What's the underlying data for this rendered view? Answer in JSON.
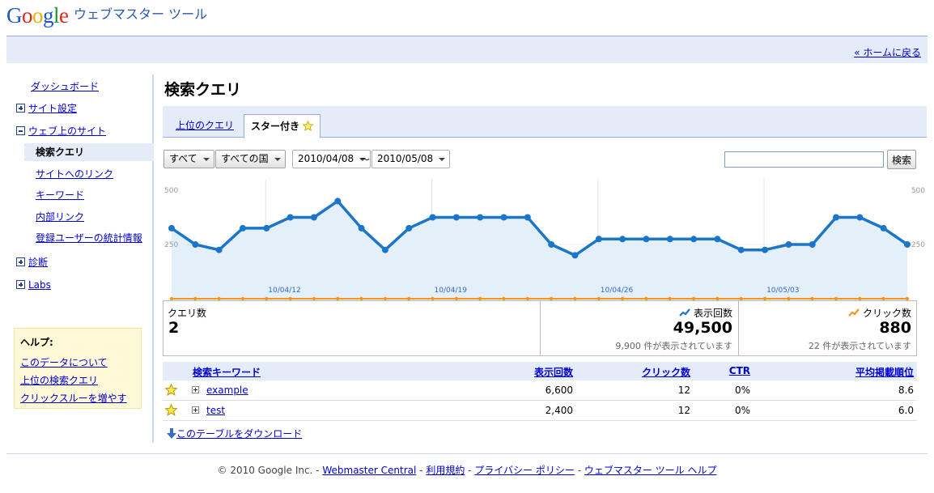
{
  "header": {
    "logo_text": "Google",
    "product_name": "ウェブマスター ツール",
    "home_link": "« ホームに戻る"
  },
  "sidebar": {
    "items": [
      {
        "label": "ダッシュボード",
        "type": "link"
      },
      {
        "label": "サイト設定",
        "type": "expandable",
        "expanded": false
      },
      {
        "label": "ウェブ上のサイト",
        "type": "expandable",
        "expanded": true
      },
      {
        "label": "検索クエリ",
        "type": "selected"
      },
      {
        "label": "サイトへのリンク",
        "type": "sub"
      },
      {
        "label": "キーワード",
        "type": "sub"
      },
      {
        "label": "内部リンク",
        "type": "sub"
      },
      {
        "label": "登録ユーザーの統計情報",
        "type": "sub"
      },
      {
        "label": "診断",
        "type": "expandable",
        "expanded": false
      },
      {
        "label": "Labs",
        "type": "expandable",
        "expanded": false
      }
    ],
    "help": {
      "title": "ヘルプ:",
      "links": [
        "このデータについて",
        "上位の検索クエリ",
        "クリックスルーを増やす"
      ]
    }
  },
  "main": {
    "title": "検索クエリ",
    "tabs": [
      {
        "label": "上位のクエリ",
        "active": false
      },
      {
        "label": "スター付き",
        "active": true
      }
    ],
    "filters": {
      "type": "すべて",
      "country": "すべての国",
      "date_from": "2010/04/08",
      "date_sep": "～",
      "date_to": "2010/05/08",
      "search_value": "",
      "search_button": "検索"
    },
    "stats": {
      "queries_label": "クエリ数",
      "queries_value": "2",
      "impressions_label": "表示回数",
      "impressions_value": "49,500",
      "impressions_sub": "9,900 件が表示されています",
      "clicks_label": "クリック数",
      "clicks_value": "880",
      "clicks_sub": "22 件が表示されています"
    },
    "table": {
      "headers": [
        "検索キーワード",
        "表示回数",
        "クリック数",
        "CTR",
        "平均掲載順位"
      ],
      "rows": [
        {
          "keyword": "example",
          "impressions": "6,600",
          "clicks": "12",
          "ctr": "0%",
          "position": "8.6"
        },
        {
          "keyword": "test",
          "impressions": "2,400",
          "clicks": "12",
          "ctr": "0%",
          "position": "6.0"
        }
      ]
    },
    "download_link": "このテーブルをダウンロード"
  },
  "chart_data": {
    "type": "line",
    "x_tick_labels": [
      "10/04/12",
      "10/04/19",
      "10/04/26",
      "10/05/03"
    ],
    "y_tick_labels": [
      "500",
      "250"
    ],
    "ylim": [
      0,
      500
    ],
    "grid": true,
    "series": [
      {
        "color": "#1b75c9",
        "values": [
          325,
          250,
          225,
          325,
          325,
          375,
          375,
          450,
          325,
          225,
          325,
          375,
          375,
          375,
          375,
          375,
          250,
          200,
          275,
          275,
          275,
          275,
          275,
          275,
          225,
          225,
          250,
          250,
          375,
          375,
          325,
          250
        ]
      },
      {
        "color": "#f7941d",
        "values": [
          0,
          0,
          0,
          0,
          0,
          0,
          0,
          0,
          0,
          0,
          0,
          0,
          0,
          0,
          0,
          0,
          0,
          0,
          0,
          0,
          0,
          0,
          0,
          0,
          0,
          0,
          0,
          0,
          0,
          0,
          0,
          0
        ]
      }
    ]
  },
  "footer": {
    "copyright": "© 2010 Google Inc. - ",
    "links": [
      "Webmaster Central",
      "利用規約",
      "プライバシー ポリシー",
      "ウェブマスター ツール ヘルプ"
    ],
    "separator": " - "
  },
  "colors": {
    "accent_bg": "#e5ecf9",
    "border_blue": "#98aee1",
    "link": "#0000cc",
    "line_blue": "#1b75c9",
    "line_orange": "#f7941d",
    "help_bg": "#fff9d7"
  }
}
